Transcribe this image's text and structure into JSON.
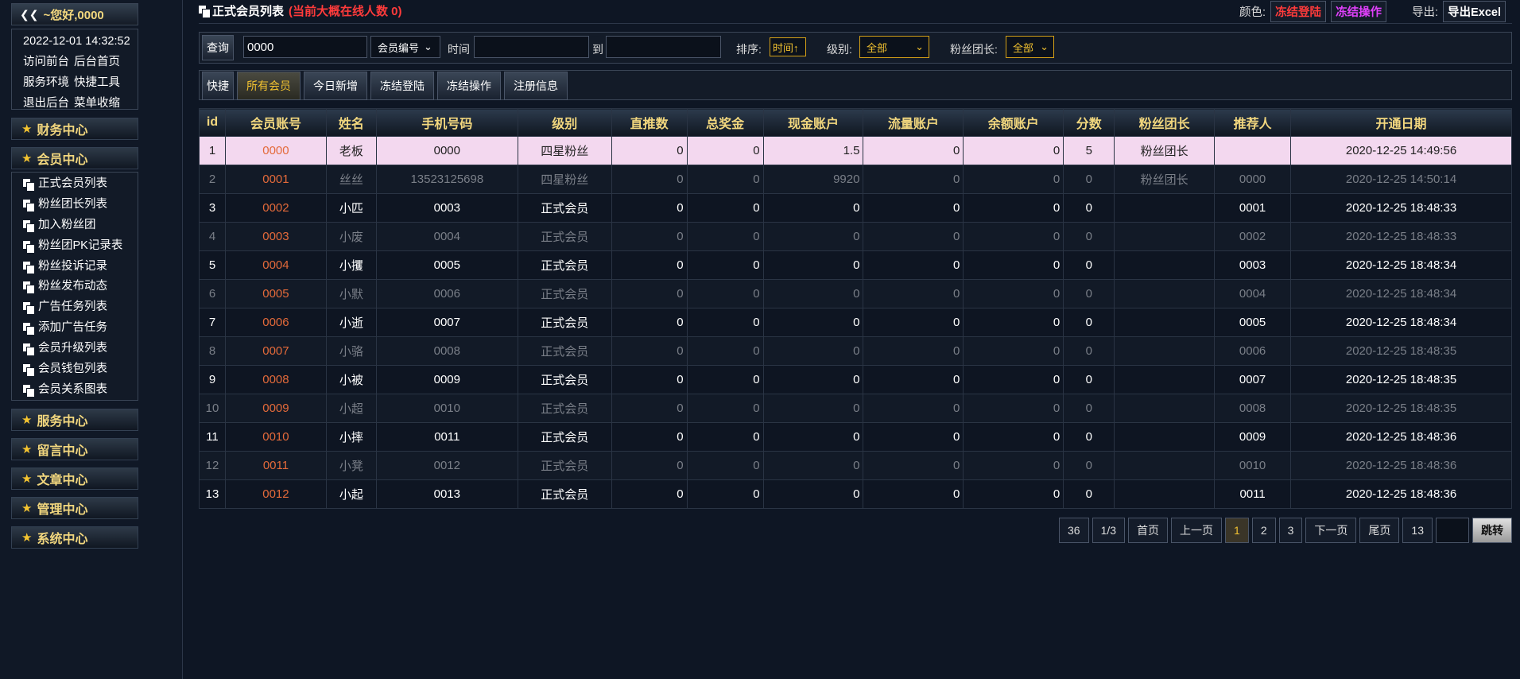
{
  "sidebar": {
    "greeting": "~您好,0000",
    "datetime": "2022-12-01 14:32:52",
    "links": [
      [
        "访问前台",
        "后台首页"
      ],
      [
        "服务环境",
        "快捷工具"
      ],
      [
        "退出后台",
        "菜单收缩"
      ]
    ],
    "sections": [
      "财务中心",
      "会员中心",
      "服务中心",
      "留言中心",
      "文章中心",
      "管理中心",
      "系统中心"
    ],
    "member_menu": [
      "正式会员列表",
      "粉丝团长列表",
      "加入粉丝团",
      "粉丝团PK记录表",
      "粉丝投诉记录",
      "粉丝发布动态",
      "广告任务列表",
      "添加广告任务",
      "会员升级列表",
      "会员钱包列表",
      "会员关系图表"
    ]
  },
  "header": {
    "title": "正式会员列表",
    "online": "(当前大概在线人数 0)",
    "color_label": "颜色:",
    "freeze_login": "冻结登陆",
    "freeze_op": "冻结操作",
    "export_label": "导出:",
    "export_excel": "导出Excel"
  },
  "filters": {
    "query_btn": "查询",
    "keyword": "0000",
    "field_select": "会员编号",
    "time_label": "时间",
    "to_label": "到",
    "sort_label": "排序:",
    "sort_value": "时间↑",
    "level_label": "级别:",
    "level_value": "全部",
    "fans_label": "粉丝团长:",
    "fans_value": "全部"
  },
  "quick": [
    "快捷",
    "所有会员",
    "今日新增",
    "冻结登陆",
    "冻结操作",
    "注册信息"
  ],
  "table": {
    "headers": [
      "id",
      "会员账号",
      "姓名",
      "手机号码",
      "级别",
      "直推数",
      "总奖金",
      "现金账户",
      "流量账户",
      "余额账户",
      "分数",
      "粉丝团长",
      "推荐人",
      "开通日期"
    ],
    "rows": [
      [
        "1",
        "0000",
        "老板",
        "0000",
        "四星粉丝",
        "0",
        "0",
        "1.5",
        "0",
        "0",
        "5",
        "粉丝团长",
        "",
        "2020-12-25 14:49:56"
      ],
      [
        "2",
        "0001",
        "丝丝",
        "13523125698",
        "四星粉丝",
        "0",
        "0",
        "9920",
        "0",
        "0",
        "0",
        "粉丝团长",
        "0000",
        "2020-12-25 14:50:14"
      ],
      [
        "3",
        "0002",
        "小匹",
        "0003",
        "正式会员",
        "0",
        "0",
        "0",
        "0",
        "0",
        "0",
        "",
        "0001",
        "2020-12-25 18:48:33"
      ],
      [
        "4",
        "0003",
        "小废",
        "0004",
        "正式会员",
        "0",
        "0",
        "0",
        "0",
        "0",
        "0",
        "",
        "0002",
        "2020-12-25 18:48:33"
      ],
      [
        "5",
        "0004",
        "小攫",
        "0005",
        "正式会员",
        "0",
        "0",
        "0",
        "0",
        "0",
        "0",
        "",
        "0003",
        "2020-12-25 18:48:34"
      ],
      [
        "6",
        "0005",
        "小默",
        "0006",
        "正式会员",
        "0",
        "0",
        "0",
        "0",
        "0",
        "0",
        "",
        "0004",
        "2020-12-25 18:48:34"
      ],
      [
        "7",
        "0006",
        "小逝",
        "0007",
        "正式会员",
        "0",
        "0",
        "0",
        "0",
        "0",
        "0",
        "",
        "0005",
        "2020-12-25 18:48:34"
      ],
      [
        "8",
        "0007",
        "小骆",
        "0008",
        "正式会员",
        "0",
        "0",
        "0",
        "0",
        "0",
        "0",
        "",
        "0006",
        "2020-12-25 18:48:35"
      ],
      [
        "9",
        "0008",
        "小被",
        "0009",
        "正式会员",
        "0",
        "0",
        "0",
        "0",
        "0",
        "0",
        "",
        "0007",
        "2020-12-25 18:48:35"
      ],
      [
        "10",
        "0009",
        "小超",
        "0010",
        "正式会员",
        "0",
        "0",
        "0",
        "0",
        "0",
        "0",
        "",
        "0008",
        "2020-12-25 18:48:35"
      ],
      [
        "11",
        "0010",
        "小摔",
        "0011",
        "正式会员",
        "0",
        "0",
        "0",
        "0",
        "0",
        "0",
        "",
        "0009",
        "2020-12-25 18:48:36"
      ],
      [
        "12",
        "0011",
        "小凳",
        "0012",
        "正式会员",
        "0",
        "0",
        "0",
        "0",
        "0",
        "0",
        "",
        "0010",
        "2020-12-25 18:48:36"
      ],
      [
        "13",
        "0012",
        "小起",
        "0013",
        "正式会员",
        "0",
        "0",
        "0",
        "0",
        "0",
        "0",
        "",
        "0011",
        "2020-12-25 18:48:36"
      ]
    ]
  },
  "pager": {
    "total": "36",
    "pages": "1/3",
    "first": "首页",
    "prev": "上一页",
    "nums": [
      "1",
      "2",
      "3"
    ],
    "next": "下一页",
    "last": "尾页",
    "per_page": "13",
    "go": "跳转"
  },
  "colors": {
    "accent_gold": "#f2d77e",
    "red": "#ff3b3b",
    "magenta": "#e040fb",
    "highlight": "#f3d8ef",
    "acct": "#e46a3a"
  }
}
